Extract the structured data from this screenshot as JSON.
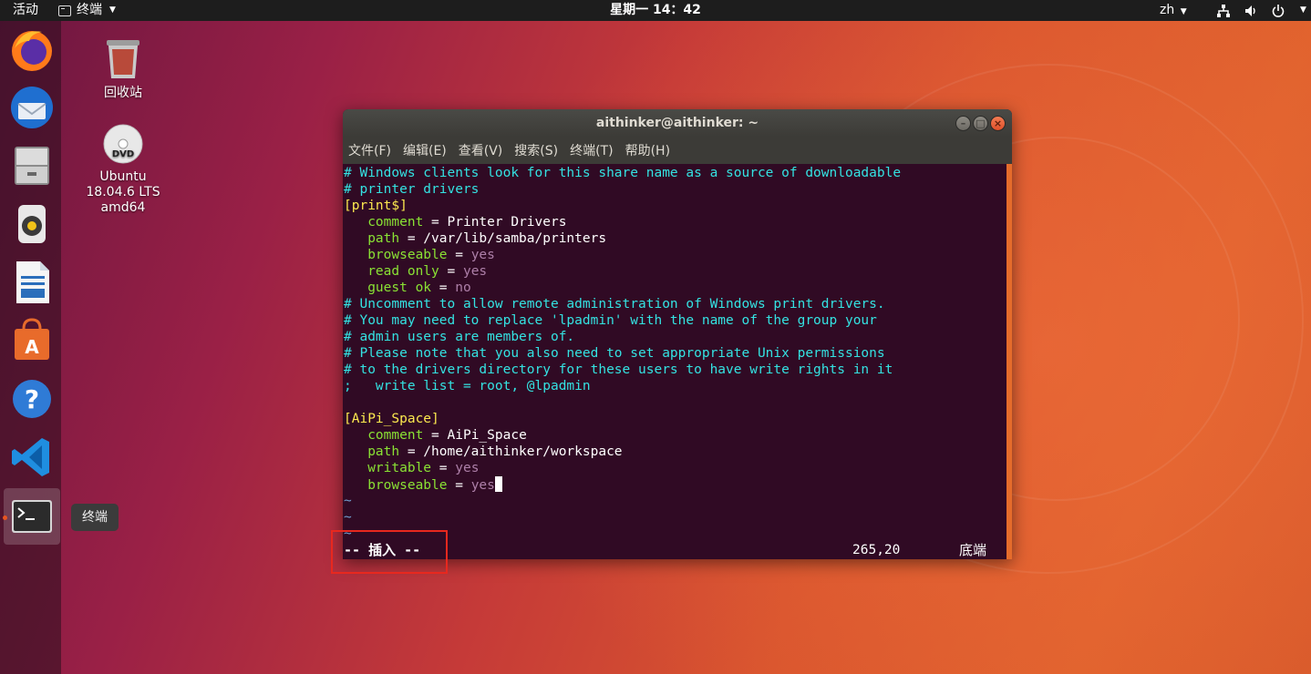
{
  "topbar": {
    "activities": "活动",
    "app_name": "终端",
    "clock": "星期一 14：42",
    "lang": "zh"
  },
  "dock": {
    "items": [
      "firefox-icon",
      "thunderbird-icon",
      "files-icon",
      "rhythmbox-icon",
      "libreoffice-writer-icon",
      "software-center-icon",
      "help-icon",
      "vscode-icon",
      "terminal-icon"
    ],
    "tooltip": "终端"
  },
  "desktop": {
    "trash_label": "回收站",
    "dvd_label_1": "Ubuntu",
    "dvd_label_2": "18.04.6 LTS",
    "dvd_label_3": "amd64"
  },
  "window": {
    "title": "aithinker@aithinker: ~",
    "menu": [
      "文件(F)",
      "编辑(E)",
      "查看(V)",
      "搜索(S)",
      "终端(T)",
      "帮助(H)"
    ]
  },
  "terminal": {
    "lines": [
      {
        "parts": [
          [
            "c-comment",
            "# Windows clients look for this share name as a source of downloadable"
          ]
        ]
      },
      {
        "parts": [
          [
            "c-comment",
            "# printer drivers"
          ]
        ]
      },
      {
        "parts": [
          [
            "c-section",
            "[print$]"
          ]
        ]
      },
      {
        "parts": [
          [
            "c-key",
            "   comment"
          ],
          [
            "c-white",
            " = Printer Drivers"
          ]
        ]
      },
      {
        "parts": [
          [
            "c-key",
            "   path"
          ],
          [
            "c-white",
            " = /var/lib/samba/printers"
          ]
        ]
      },
      {
        "parts": [
          [
            "c-key",
            "   browseable"
          ],
          [
            "c-white",
            " = "
          ],
          [
            "c-val",
            "yes"
          ]
        ]
      },
      {
        "parts": [
          [
            "c-key",
            "   read only"
          ],
          [
            "c-white",
            " = "
          ],
          [
            "c-val",
            "yes"
          ]
        ]
      },
      {
        "parts": [
          [
            "c-key",
            "   guest ok"
          ],
          [
            "c-white",
            " = "
          ],
          [
            "c-val",
            "no"
          ]
        ]
      },
      {
        "parts": [
          [
            "c-comment",
            "# Uncomment to allow remote administration of Windows print drivers."
          ]
        ]
      },
      {
        "parts": [
          [
            "c-comment",
            "# You may need to replace 'lpadmin' with the name of the group your"
          ]
        ]
      },
      {
        "parts": [
          [
            "c-comment",
            "# admin users are members of."
          ]
        ]
      },
      {
        "parts": [
          [
            "c-comment",
            "# Please note that you also need to set appropriate Unix permissions"
          ]
        ]
      },
      {
        "parts": [
          [
            "c-comment",
            "# to the drivers directory for these users to have write rights in it"
          ]
        ]
      },
      {
        "parts": [
          [
            "c-comment",
            ";   write list = root, @lpadmin"
          ]
        ]
      },
      {
        "parts": [
          [
            "c-white",
            ""
          ]
        ]
      },
      {
        "parts": [
          [
            "c-section",
            "[AiPi_Space]"
          ]
        ]
      },
      {
        "parts": [
          [
            "c-key",
            "   comment"
          ],
          [
            "c-white",
            " = AiPi_Space"
          ]
        ]
      },
      {
        "parts": [
          [
            "c-key",
            "   path"
          ],
          [
            "c-white",
            " = /home/aithinker/workspace"
          ]
        ]
      },
      {
        "parts": [
          [
            "c-key",
            "   writable"
          ],
          [
            "c-white",
            " = "
          ],
          [
            "c-val",
            "yes"
          ]
        ]
      },
      {
        "parts": [
          [
            "c-key",
            "   browseable"
          ],
          [
            "c-white",
            " = "
          ],
          [
            "c-val",
            "yes"
          ]
        ],
        "cursor": true
      },
      {
        "parts": [
          [
            "c-tilde",
            "~"
          ]
        ]
      },
      {
        "parts": [
          [
            "c-tilde",
            "~"
          ]
        ]
      },
      {
        "parts": [
          [
            "c-tilde",
            "~"
          ]
        ]
      }
    ],
    "status_mode": "-- 插入 --",
    "status_pos": "265,20",
    "status_pct": "底端"
  },
  "colors": {
    "terminal_bg": "#300a24",
    "comment": "#34e2e2",
    "section": "#fce94f",
    "key": "#8ae234",
    "value": "#ad7fa8",
    "highlight_box": "#e8281e"
  }
}
